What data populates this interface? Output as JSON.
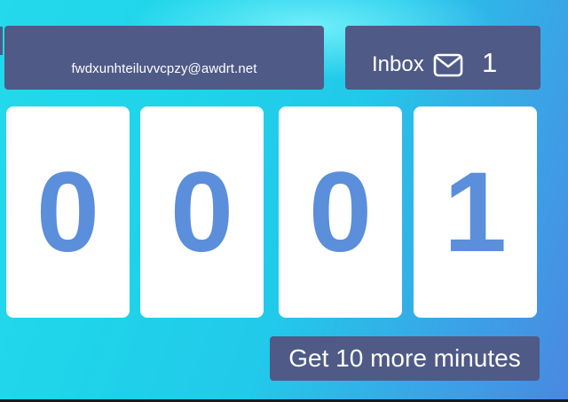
{
  "email": {
    "address": "fwdxunhteiluvvcpzy@awdrt.net"
  },
  "inbox": {
    "label": "Inbox",
    "icon": "mail-icon",
    "count": "1"
  },
  "timer": {
    "digits": [
      "0",
      "0",
      "0",
      "1"
    ]
  },
  "actions": {
    "more_minutes_label": "Get 10 more minutes"
  },
  "colors": {
    "panel": "#4f5a86",
    "digit_text": "#5b8edb",
    "background_start": "#25d9ec",
    "background_end": "#4a88e2"
  }
}
